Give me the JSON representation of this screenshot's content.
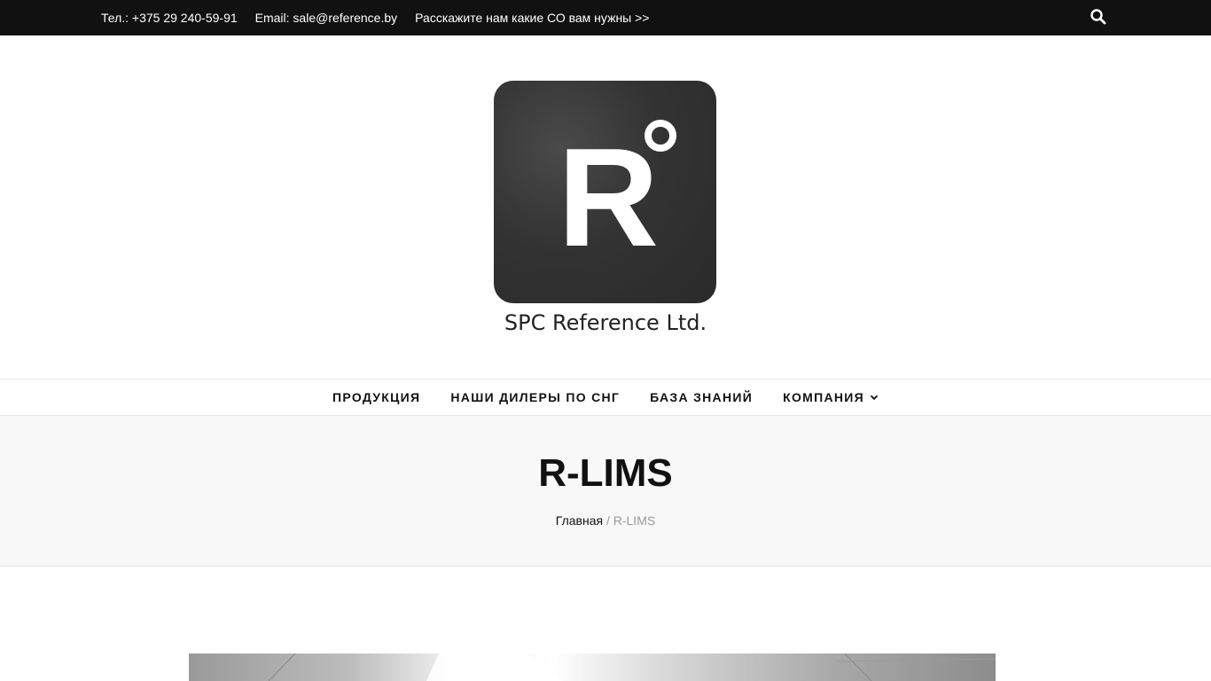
{
  "topbar": {
    "phone": "Тел.: +375 29 240-59-91",
    "email": "Email: sale@reference.by",
    "request_link": "Расскажите нам какие СО вам нужны >>"
  },
  "header": {
    "logo_letter": "R",
    "site_title": "SPC Reference Ltd."
  },
  "nav": {
    "items": [
      {
        "label": "ПРОДУКЦИЯ"
      },
      {
        "label": "НАШИ ДИЛЕРЫ ПО СНГ"
      },
      {
        "label": "БАЗА ЗНАНИЙ"
      },
      {
        "label": "КОМПАНИЯ",
        "has_dropdown": true
      }
    ]
  },
  "banner": {
    "title": "R-LIMS",
    "breadcrumb": {
      "home": "Главная",
      "separator": "/",
      "current": "R-LIMS"
    }
  },
  "icons": {
    "search": "search-icon",
    "dropdown": "chevron-down-icon"
  },
  "colors": {
    "topbar_bg": "#111111",
    "logo_bg": "#333333",
    "banner_bg": "#f8f8f8"
  }
}
